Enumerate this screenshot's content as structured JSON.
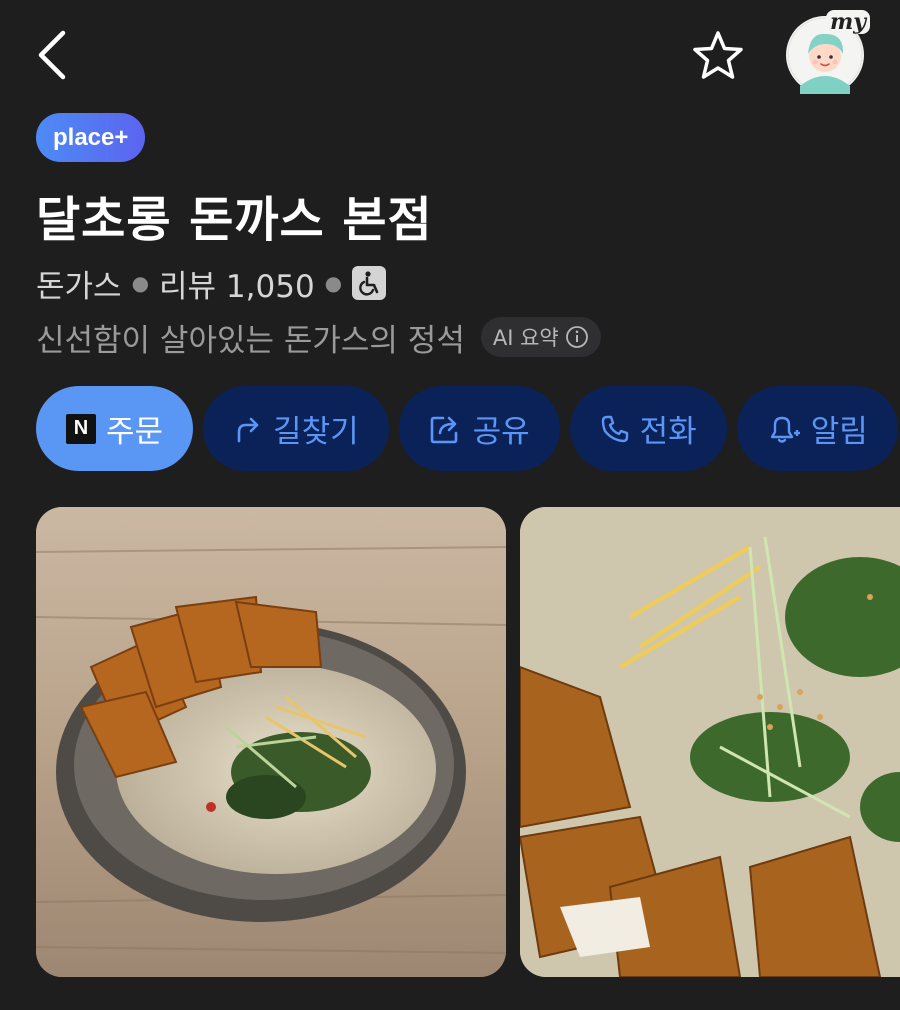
{
  "header": {
    "back_icon": "chevron-left-icon",
    "favorite_icon": "star-outline-icon",
    "profile_badge": "my"
  },
  "place": {
    "badge": "place+",
    "name": "달초롱 돈까스 본점",
    "category": "돈가스",
    "review_label": "리뷰",
    "review_count": "1,050",
    "accessibility_icon": "wheelchair-icon",
    "summary": "신선함이 살아있는 돈가스의 정석",
    "ai_label": "AI 요약",
    "ai_info_icon": "info-icon"
  },
  "actions": [
    {
      "label": "주문",
      "icon": "naver-n-icon"
    },
    {
      "label": "길찾기",
      "icon": "turn-arrow-icon"
    },
    {
      "label": "공유",
      "icon": "share-icon"
    },
    {
      "label": "전화",
      "icon": "phone-icon"
    },
    {
      "label": "알림",
      "icon": "bell-plus-icon"
    }
  ],
  "colors": {
    "background": "#1e1e1f",
    "primary_button": "#5a96f4",
    "secondary_button": "#0a2258",
    "secondary_text": "#5b95f5",
    "badge_gradient_start": "#4d8bf5",
    "badge_gradient_end": "#5c64f0"
  }
}
